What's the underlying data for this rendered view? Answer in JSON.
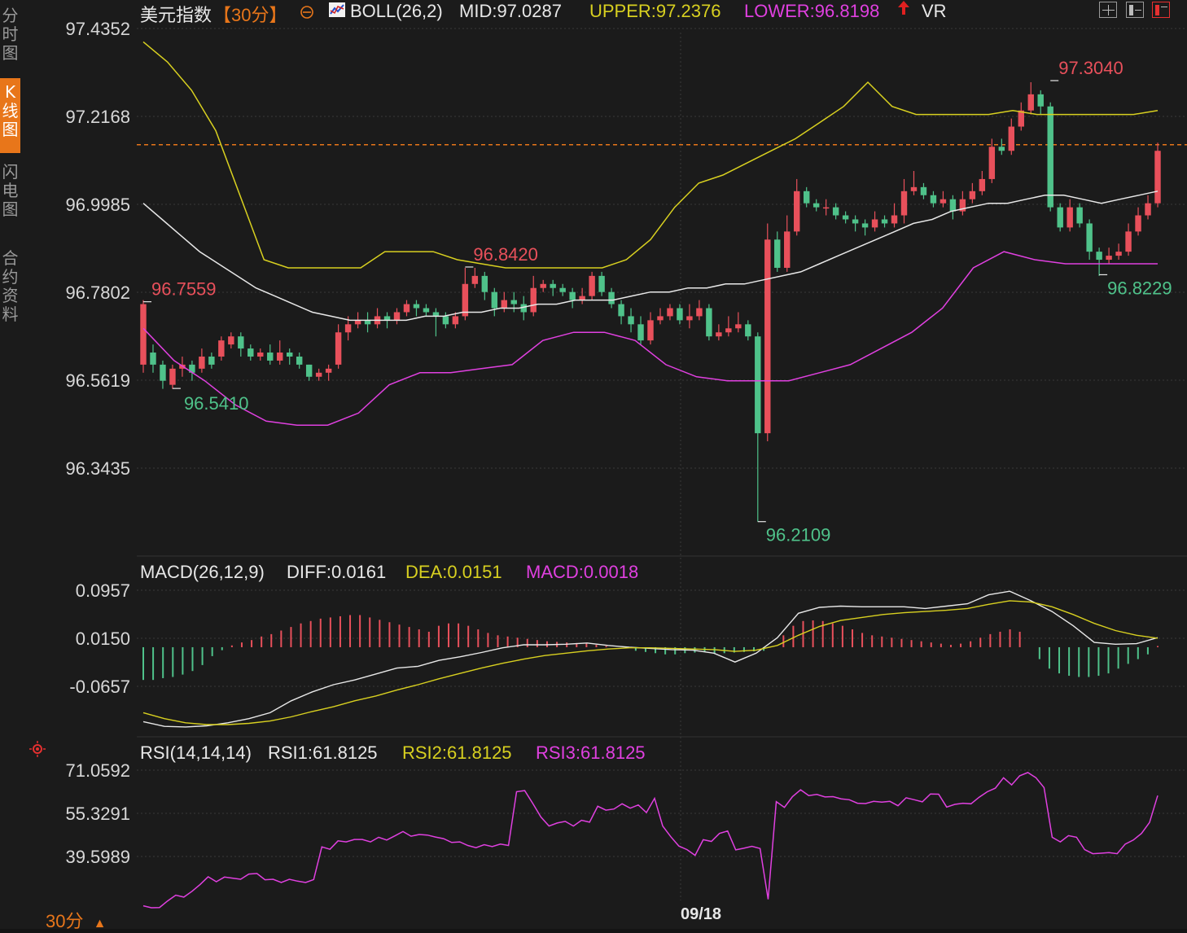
{
  "sidebar": {
    "tabs": [
      {
        "label": "分时图",
        "active": false
      },
      {
        "label": "K线图",
        "active": true
      },
      {
        "label": "闪电图",
        "active": false
      },
      {
        "label": "合约资料",
        "active": false
      }
    ]
  },
  "header": {
    "symbol": "美元指数",
    "period_tag": "【30分】",
    "indicator_name": "BOLL(26,2)",
    "mid": "MID:97.0287",
    "upper": "UPPER:97.2376",
    "lower": "LOWER:96.8198",
    "vr_label": "VR",
    "arrow_icon": "up-arrow-icon",
    "circle_icon": "plus-circle-icon",
    "boll_icon": "chart-icon"
  },
  "macd_header": {
    "name": "MACD(26,12,9)",
    "diff": "DIFF:0.0161",
    "dea": "DEA:0.0151",
    "macd": "MACD:0.0018"
  },
  "rsi_header": {
    "name": "RSI(14,14,14)",
    "rsi1": "RSI1:61.8125",
    "rsi2": "RSI2:61.8125",
    "rsi3": "RSI3:61.8125",
    "icon": "settings-icon"
  },
  "footer": {
    "period": "30分",
    "period_arrow": "▲",
    "date_label": "09/18"
  },
  "colors": {
    "up": "#e8505b",
    "down": "#4fc28a",
    "upper": "#d8d020",
    "lower": "#e040e0",
    "mid": "#e8e8e8",
    "accent": "#e8761a"
  },
  "chart_data": [
    {
      "type": "candlestick",
      "title": "美元指数 30分 BOLL(26,2)",
      "y_ticks": [
        "97.4352",
        "97.2168",
        "96.9985",
        "96.7802",
        "96.5619",
        "96.3435"
      ],
      "ylim": [
        96.2109,
        97.4352
      ],
      "reference_line": 97.1451,
      "annotations": [
        {
          "label": "96.7559",
          "value": 96.7559,
          "kind": "high"
        },
        {
          "label": "96.5410",
          "value": 96.541,
          "kind": "low"
        },
        {
          "label": "96.8420",
          "value": 96.842,
          "kind": "high"
        },
        {
          "label": "96.2109",
          "value": 96.2109,
          "kind": "low"
        },
        {
          "label": "97.3040",
          "value": 97.304,
          "kind": "high"
        },
        {
          "label": "96.8229",
          "value": 96.8229,
          "kind": "low"
        }
      ],
      "candles": [
        [
          96.6,
          96.75,
          96.76,
          96.58
        ],
        [
          96.63,
          96.6,
          96.65,
          96.58
        ],
        [
          96.6,
          96.56,
          96.61,
          96.54
        ],
        [
          96.55,
          96.59,
          96.6,
          96.54
        ],
        [
          96.59,
          96.6,
          96.62,
          96.57
        ],
        [
          96.6,
          96.58,
          96.61,
          96.56
        ],
        [
          96.59,
          96.62,
          96.64,
          96.58
        ],
        [
          96.62,
          96.6,
          96.63,
          96.59
        ],
        [
          96.62,
          96.66,
          96.67,
          96.61
        ],
        [
          96.65,
          96.67,
          96.68,
          96.64
        ],
        [
          96.67,
          96.64,
          96.68,
          96.62
        ],
        [
          96.64,
          96.62,
          96.65,
          96.61
        ],
        [
          96.62,
          96.63,
          96.64,
          96.61
        ],
        [
          96.63,
          96.61,
          96.65,
          96.6
        ],
        [
          96.61,
          96.63,
          96.66,
          96.6
        ],
        [
          96.63,
          96.62,
          96.64,
          96.6
        ],
        [
          96.62,
          96.6,
          96.63,
          96.59
        ],
        [
          96.6,
          96.57,
          96.6,
          96.56
        ],
        [
          96.57,
          96.58,
          96.59,
          96.56
        ],
        [
          96.58,
          96.59,
          96.6,
          96.56
        ],
        [
          96.6,
          96.68,
          96.7,
          96.59
        ],
        [
          96.68,
          96.7,
          96.72,
          96.66
        ],
        [
          96.7,
          96.71,
          96.73,
          96.69
        ],
        [
          96.71,
          96.7,
          96.73,
          96.68
        ],
        [
          96.7,
          96.72,
          96.74,
          96.69
        ],
        [
          96.72,
          96.71,
          96.73,
          96.69
        ],
        [
          96.71,
          96.73,
          96.74,
          96.7
        ],
        [
          96.73,
          96.75,
          96.76,
          96.72
        ],
        [
          96.75,
          96.74,
          96.76,
          96.72
        ],
        [
          96.74,
          96.73,
          96.75,
          96.72
        ],
        [
          96.73,
          96.72,
          96.74,
          96.67
        ],
        [
          96.72,
          96.7,
          96.73,
          96.69
        ],
        [
          96.7,
          96.72,
          96.73,
          96.69
        ],
        [
          96.72,
          96.8,
          96.84,
          96.71
        ],
        [
          96.8,
          96.82,
          96.84,
          96.79
        ],
        [
          96.82,
          96.78,
          96.83,
          96.76
        ],
        [
          96.78,
          96.74,
          96.79,
          96.72
        ],
        [
          96.74,
          96.76,
          96.78,
          96.73
        ],
        [
          96.76,
          96.75,
          96.78,
          96.73
        ],
        [
          96.75,
          96.73,
          96.77,
          96.71
        ],
        [
          96.73,
          96.79,
          96.82,
          96.72
        ],
        [
          96.79,
          96.8,
          96.81,
          96.78
        ],
        [
          96.8,
          96.79,
          96.81,
          96.77
        ],
        [
          96.79,
          96.78,
          96.8,
          96.77
        ],
        [
          96.78,
          96.76,
          96.79,
          96.74
        ],
        [
          96.76,
          96.77,
          96.79,
          96.75
        ],
        [
          96.77,
          96.82,
          96.83,
          96.76
        ],
        [
          96.82,
          96.78,
          96.83,
          96.77
        ],
        [
          96.78,
          96.75,
          96.79,
          96.74
        ],
        [
          96.75,
          96.72,
          96.76,
          96.7
        ],
        [
          96.72,
          96.7,
          96.74,
          96.68
        ],
        [
          96.7,
          96.66,
          96.72,
          96.65
        ],
        [
          96.66,
          96.71,
          96.73,
          96.65
        ],
        [
          96.71,
          96.72,
          96.74,
          96.7
        ],
        [
          96.72,
          96.74,
          96.75,
          96.71
        ],
        [
          96.74,
          96.71,
          96.75,
          96.7
        ],
        [
          96.71,
          96.72,
          96.75,
          96.69
        ],
        [
          96.72,
          96.74,
          96.76,
          96.71
        ],
        [
          96.74,
          96.67,
          96.75,
          96.66
        ],
        [
          96.67,
          96.68,
          96.7,
          96.66
        ],
        [
          96.68,
          96.69,
          96.72,
          96.67
        ],
        [
          96.69,
          96.7,
          96.73,
          96.68
        ],
        [
          96.7,
          96.67,
          96.71,
          96.66
        ],
        [
          96.67,
          96.43,
          96.68,
          96.2109
        ],
        [
          96.43,
          96.91,
          96.95,
          96.41
        ],
        [
          96.91,
          96.84,
          96.93,
          96.83
        ],
        [
          96.84,
          96.93,
          96.97,
          96.83
        ],
        [
          96.93,
          97.03,
          97.06,
          96.92
        ],
        [
          97.03,
          97.0,
          97.04,
          96.99
        ],
        [
          97.0,
          96.99,
          97.01,
          96.98
        ],
        [
          96.99,
          96.99,
          97.01,
          96.97
        ],
        [
          96.99,
          96.97,
          97.0,
          96.96
        ],
        [
          96.97,
          96.96,
          96.98,
          96.95
        ],
        [
          96.96,
          96.95,
          96.97,
          96.93
        ],
        [
          96.95,
          96.94,
          96.96,
          96.92
        ],
        [
          96.94,
          96.96,
          96.98,
          96.93
        ],
        [
          96.96,
          96.95,
          96.97,
          96.94
        ],
        [
          96.95,
          96.97,
          97.0,
          96.94
        ],
        [
          96.97,
          97.03,
          97.06,
          96.95
        ],
        [
          97.03,
          97.04,
          97.08,
          97.02
        ],
        [
          97.04,
          97.02,
          97.05,
          97.01
        ],
        [
          97.02,
          97.0,
          97.03,
          96.99
        ],
        [
          97.0,
          97.01,
          97.03,
          96.99
        ],
        [
          97.01,
          96.98,
          97.02,
          96.96
        ],
        [
          96.98,
          97.01,
          97.03,
          96.97
        ],
        [
          97.01,
          97.03,
          97.05,
          97.0
        ],
        [
          97.03,
          97.06,
          97.08,
          97.02
        ],
        [
          97.06,
          97.14,
          97.16,
          97.05
        ],
        [
          97.14,
          97.13,
          97.16,
          97.12
        ],
        [
          97.13,
          97.19,
          97.21,
          97.12
        ],
        [
          97.19,
          97.23,
          97.25,
          97.18
        ],
        [
          97.23,
          97.27,
          97.3,
          97.22
        ],
        [
          97.27,
          97.24,
          97.28,
          97.22
        ],
        [
          97.24,
          96.99,
          97.25,
          96.98
        ],
        [
          96.99,
          96.94,
          97.0,
          96.93
        ],
        [
          96.94,
          96.99,
          97.01,
          96.93
        ],
        [
          96.99,
          96.95,
          97.0,
          96.94
        ],
        [
          96.95,
          96.88,
          96.96,
          96.86
        ],
        [
          96.88,
          96.86,
          96.89,
          96.82
        ],
        [
          96.86,
          96.87,
          96.89,
          96.85
        ],
        [
          96.87,
          96.88,
          96.9,
          96.86
        ],
        [
          96.88,
          96.93,
          96.95,
          96.87
        ],
        [
          96.93,
          96.97,
          96.99,
          96.92
        ],
        [
          96.97,
          97.0,
          97.02,
          96.96
        ],
        [
          97.0,
          97.13,
          97.15,
          96.99
        ]
      ],
      "mid_line": [
        97.0,
        96.96,
        96.92,
        96.88,
        96.85,
        96.82,
        96.79,
        96.77,
        96.75,
        96.73,
        96.72,
        96.71,
        96.71,
        96.71,
        96.71,
        96.72,
        96.72,
        96.73,
        96.73,
        96.74,
        96.74,
        96.75,
        96.75,
        96.76,
        96.76,
        96.76,
        96.77,
        96.78,
        96.78,
        96.79,
        96.79,
        96.8,
        96.8,
        96.81,
        96.82,
        96.83,
        96.85,
        96.87,
        96.89,
        96.91,
        96.93,
        96.95,
        96.96,
        96.98,
        96.99,
        97.0,
        97.0,
        97.01,
        97.02,
        97.02,
        97.01,
        97.0,
        97.01,
        97.02,
        97.03
      ],
      "upper_line": [
        97.4,
        97.35,
        97.28,
        97.18,
        97.02,
        96.86,
        96.84,
        96.84,
        96.84,
        96.84,
        96.88,
        96.88,
        96.88,
        96.86,
        96.85,
        96.84,
        96.84,
        96.84,
        96.84,
        96.84,
        96.86,
        96.91,
        96.99,
        97.05,
        97.07,
        97.1,
        97.13,
        97.16,
        97.2,
        97.24,
        97.3,
        97.24,
        97.22,
        97.22,
        97.22,
        97.22,
        97.23,
        97.22,
        97.22,
        97.22,
        97.22,
        97.22,
        97.23
      ],
      "lower_line": [
        96.69,
        96.61,
        96.56,
        96.5,
        96.46,
        96.45,
        96.45,
        96.48,
        96.55,
        96.58,
        96.58,
        96.59,
        96.6,
        96.66,
        96.68,
        96.68,
        96.66,
        96.6,
        96.57,
        96.56,
        96.56,
        96.56,
        96.58,
        96.6,
        96.64,
        96.68,
        96.74,
        96.84,
        96.88,
        96.86,
        96.85,
        96.85,
        96.85,
        96.85
      ],
      "ylabel": ""
    },
    {
      "type": "bar",
      "title": "MACD(26,12,9)",
      "y_ticks": [
        "0.0957",
        "0.0150",
        "-0.0657"
      ],
      "ylim": [
        -0.14,
        0.12
      ],
      "diff_line": [
        -0.125,
        -0.133,
        -0.134,
        -0.132,
        -0.127,
        -0.12,
        -0.11,
        -0.09,
        -0.075,
        -0.063,
        -0.055,
        -0.045,
        -0.035,
        -0.032,
        -0.022,
        -0.016,
        -0.009,
        -0.001,
        0.004,
        0.004,
        0.005,
        0.007,
        0.003,
        0.0,
        -0.002,
        -0.004,
        -0.005,
        -0.01,
        -0.025,
        -0.01,
        0.016,
        0.057,
        0.067,
        0.069,
        0.068,
        0.068,
        0.068,
        0.065,
        0.069,
        0.073,
        0.088,
        0.094,
        0.078,
        0.06,
        0.036,
        0.008,
        0.005,
        0.006,
        0.0161
      ],
      "dea_line": [
        -0.11,
        -0.12,
        -0.127,
        -0.13,
        -0.13,
        -0.128,
        -0.124,
        -0.117,
        -0.108,
        -0.1,
        -0.09,
        -0.082,
        -0.072,
        -0.063,
        -0.053,
        -0.044,
        -0.035,
        -0.027,
        -0.02,
        -0.014,
        -0.01,
        -0.006,
        -0.003,
        -0.001,
        -0.001,
        -0.002,
        -0.003,
        -0.004,
        -0.007,
        -0.005,
        0.003,
        0.02,
        0.035,
        0.045,
        0.05,
        0.055,
        0.058,
        0.06,
        0.062,
        0.065,
        0.072,
        0.078,
        0.076,
        0.068,
        0.055,
        0.04,
        0.028,
        0.02,
        0.0151
      ],
      "histogram": [
        -0.055,
        -0.055,
        -0.052,
        -0.05,
        -0.046,
        -0.04,
        -0.03,
        -0.015,
        -0.005,
        0.003,
        0.008,
        0.012,
        0.018,
        0.022,
        0.028,
        0.034,
        0.04,
        0.044,
        0.048,
        0.05,
        0.052,
        0.054,
        0.054,
        0.05,
        0.046,
        0.042,
        0.038,
        0.034,
        0.03,
        0.026,
        0.036,
        0.04,
        0.04,
        0.036,
        0.03,
        0.024,
        0.02,
        0.018,
        0.016,
        0.014,
        0.012,
        0.01,
        0.009,
        0.008,
        0.007,
        0.006,
        0.004,
        0.002,
        0.0,
        -0.002,
        -0.006,
        -0.008,
        -0.01,
        -0.012,
        -0.012,
        -0.01,
        -0.009,
        -0.008,
        -0.01,
        -0.01,
        -0.009,
        -0.008,
        -0.007,
        -0.006,
        0.0,
        0.02,
        0.036,
        0.044,
        0.045,
        0.044,
        0.04,
        0.036,
        0.03,
        0.024,
        0.02,
        0.018,
        0.016,
        0.014,
        0.012,
        0.01,
        0.008,
        0.006,
        0.004,
        0.006,
        0.01,
        0.016,
        0.022,
        0.026,
        0.03,
        0.026,
        0.0,
        -0.02,
        -0.036,
        -0.044,
        -0.048,
        -0.05,
        -0.05,
        -0.048,
        -0.044,
        -0.036,
        -0.028,
        -0.02,
        -0.012,
        0.002
      ]
    },
    {
      "type": "line",
      "title": "RSI(14,14,14)",
      "y_ticks": [
        "71.0592",
        "55.3291",
        "39.5989"
      ],
      "ylim": [
        20,
        75
      ],
      "rsi_line": [
        21.6,
        20.9,
        21.0,
        23.4,
        25.5,
        24.8,
        26.9,
        29.4,
        32.2,
        30.4,
        32.1,
        31.7,
        31.3,
        33.2,
        33.4,
        31.1,
        31.3,
        30.1,
        31.3,
        30.6,
        30.1,
        31.2,
        43.1,
        42.2,
        45.3,
        44.9,
        45.8,
        45.8,
        44.9,
        46.6,
        45.6,
        47.1,
        48.7,
        47.0,
        47.6,
        47.4,
        46.7,
        46.1,
        44.7,
        44.9,
        43.6,
        42.8,
        43.9,
        43.2,
        44.1,
        43.6,
        63.2,
        63.6,
        58.9,
        54.0,
        50.7,
        51.8,
        52.4,
        50.7,
        52.8,
        52.1,
        57.9,
        56.5,
        56.9,
        58.8,
        57.2,
        58.4,
        55.6,
        60.8,
        50.7,
        46.8,
        43.4,
        42.1,
        40.0,
        45.7,
        45.1,
        48.0,
        48.9,
        42.0,
        42.6,
        43.3,
        42.5,
        24.0,
        59.6,
        57.5,
        61.4,
        63.9,
        61.8,
        62.2,
        61.3,
        61.4,
        60.6,
        60.3,
        59.0,
        58.9,
        59.7,
        59.4,
        59.7,
        58.1,
        61.0,
        60.3,
        59.5,
        62.4,
        62.3,
        57.6,
        58.6,
        59.0,
        58.8,
        61.2,
        63.2,
        64.5,
        68.3,
        65.7,
        69.0,
        70.2,
        68.3,
        64.7,
        46.6,
        44.9,
        47.2,
        46.6,
        42.1,
        40.6,
        40.8,
        41.0,
        40.6,
        44.1,
        45.6,
        48.0,
        52.0,
        61.8
      ]
    }
  ]
}
